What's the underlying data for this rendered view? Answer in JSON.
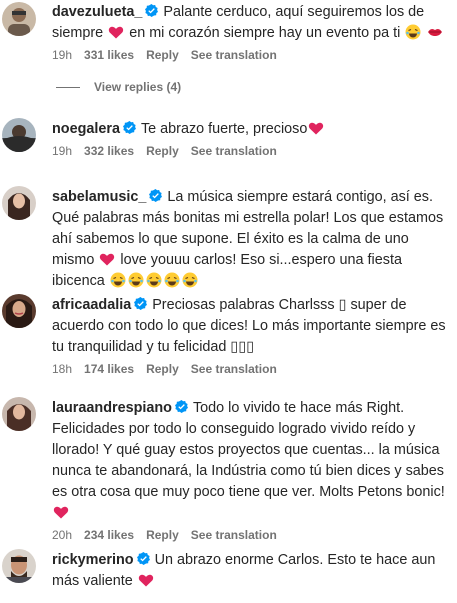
{
  "comments": [
    {
      "username": "davezulueta_",
      "text_1": "Palante cerduco, aquí seguiremos los de siempre",
      "text_2": "en mi corazón siempre hay un evento pa ti",
      "time": "19h",
      "likes": "331 likes",
      "reply": "Reply",
      "translate": "See translation",
      "view_replies": "View replies (4)"
    },
    {
      "username": "noegalera",
      "text_1": "Te abrazo fuerte, precioso",
      "time": "19h",
      "likes": "332 likes",
      "reply": "Reply",
      "translate": "See translation"
    },
    {
      "username": "sabelamusic_",
      "text_1": "La música siempre estará contigo, así es. Qué palabras más bonitas mi estrella polar! Los que estamos ahí sabemos lo que supone. El éxito es la calma de uno mismo",
      "text_2": "love youuu carlos! Eso si...espero una fiesta ibicenca"
    },
    {
      "username": "africaadalia",
      "text_1": "Preciosas palabras Charlsss",
      "text_2": "super de acuerdo con todo lo que dices! Lo más importante siempre es tu tranquilidad y tu felicidad",
      "boxes": "▯▯▯",
      "box_1": "▯",
      "time": "18h",
      "likes": "174 likes",
      "reply": "Reply",
      "translate": "See translation"
    },
    {
      "username": "lauraandrespiano",
      "text_1": "Todo lo vivido te hace más Right. Felicidades por todo lo conseguido logrado vivido reído y llorado! Y qué guay estos proyectos que cuentas... la música nunca te abandonará, la Indústria como tú bien dices y sabes es otra cosa que muy poco tiene que ver. Molts Petons bonic!",
      "time": "20h",
      "likes": "234 likes",
      "reply": "Reply",
      "translate": "See translation"
    },
    {
      "username": "rickymerino",
      "text_1": "Un abrazo enorme Carlos. Esto te hace aun más valiente"
    }
  ],
  "colors": {
    "text": "#262626",
    "meta": "#737373",
    "verified": "#0095f6",
    "heart": "#e0245e"
  },
  "icons": [
    "verified-badge-icon",
    "red-heart-emoji",
    "kiss-lips-emoji",
    "laughing-tears-emoji"
  ]
}
